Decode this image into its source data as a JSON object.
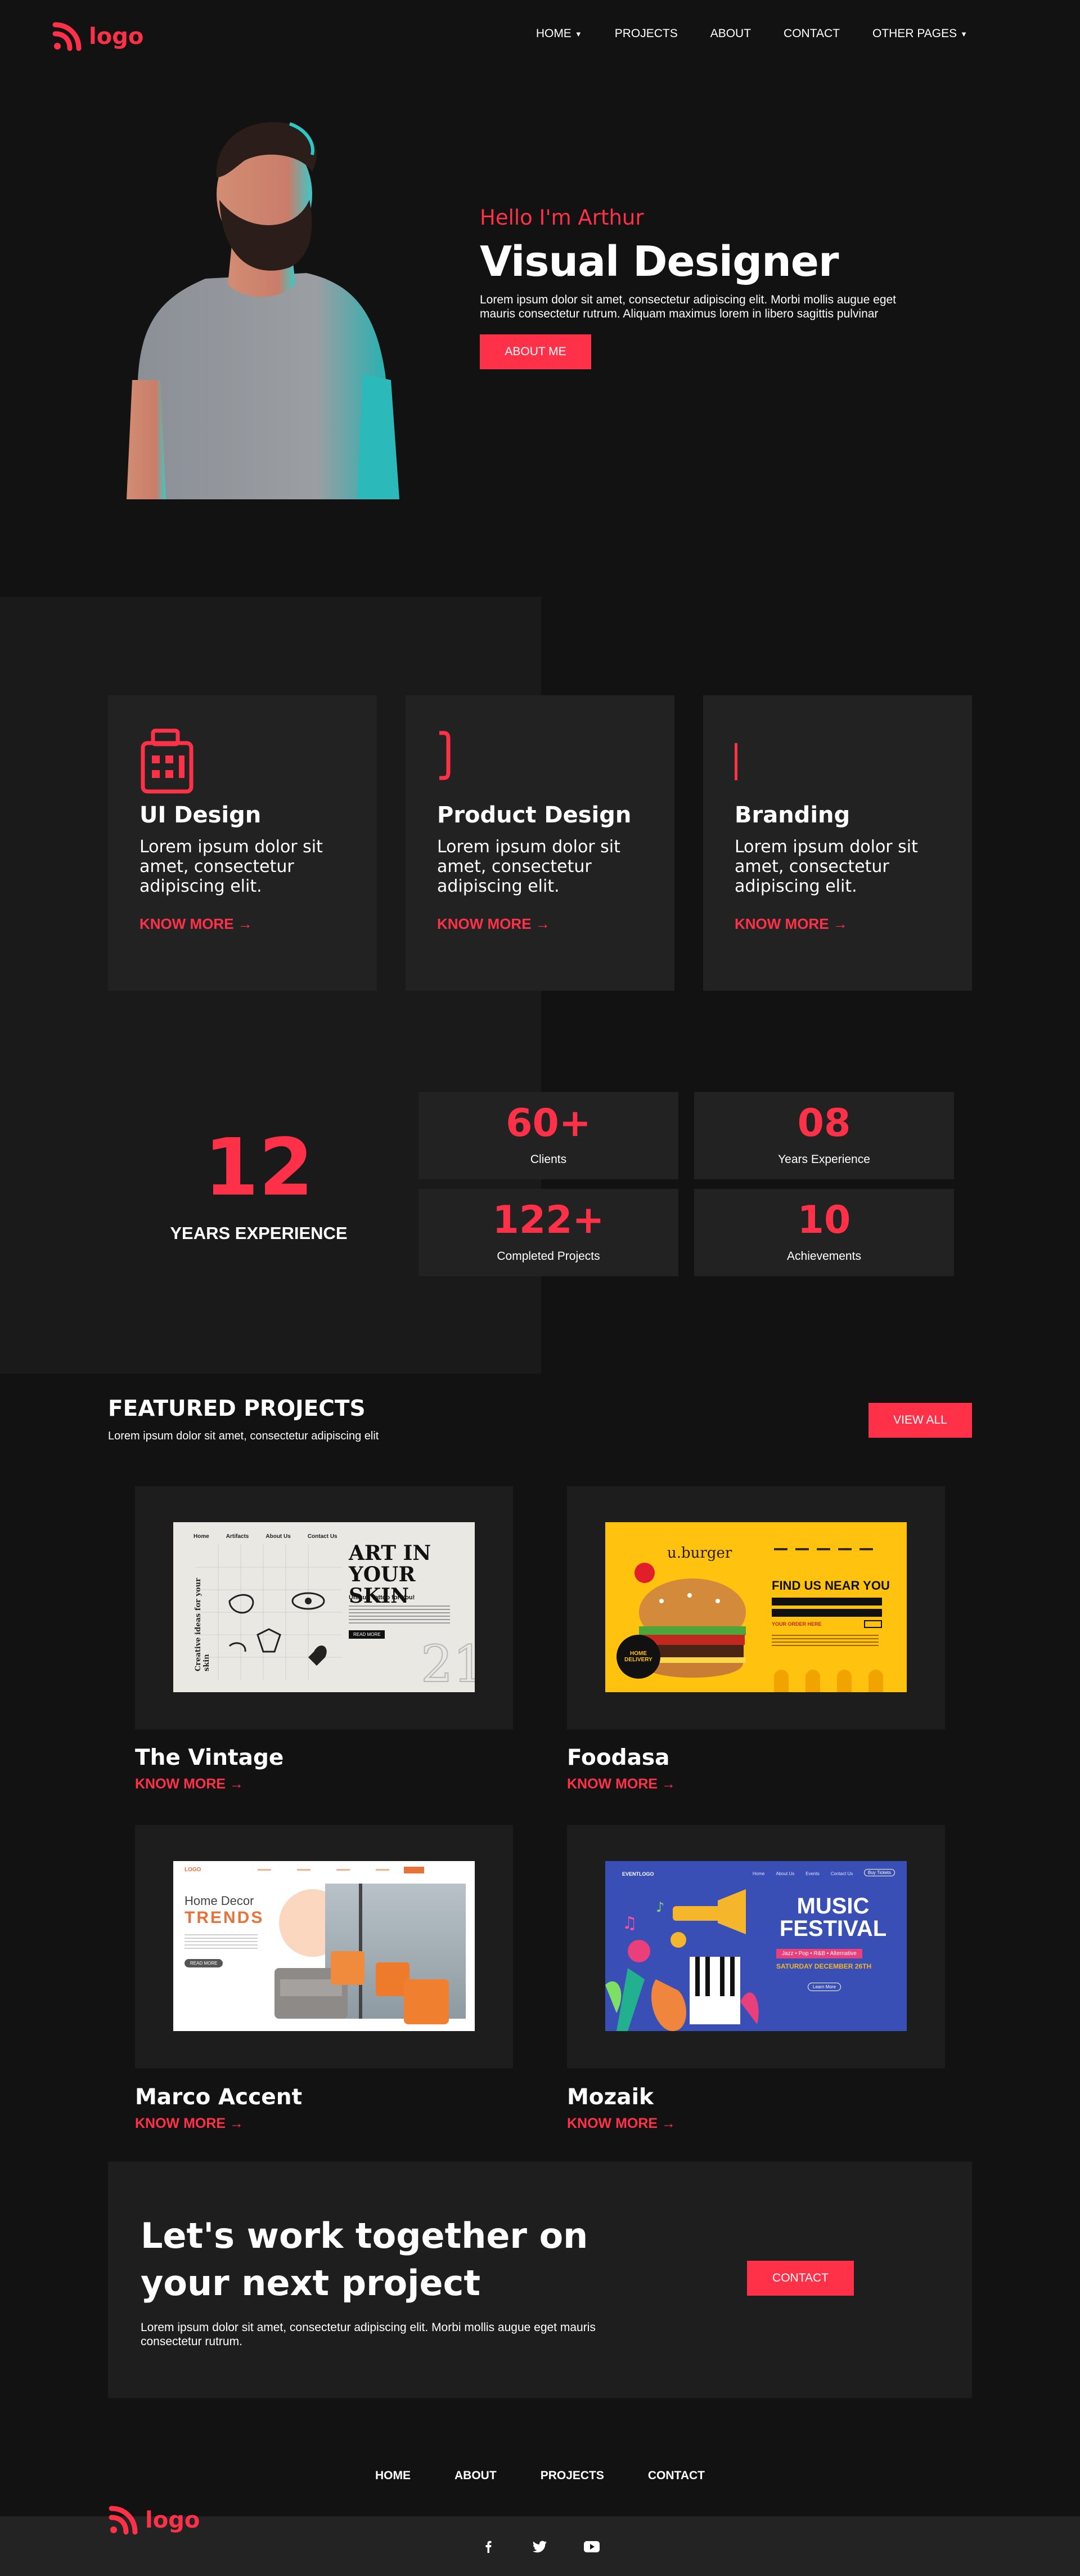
{
  "header": {
    "logo_text": "logo",
    "nav": [
      {
        "label": "HOME",
        "dropdown": true
      },
      {
        "label": "PROJECTS",
        "dropdown": false
      },
      {
        "label": "ABOUT",
        "dropdown": false
      },
      {
        "label": "CONTACT",
        "dropdown": false
      },
      {
        "label": "OTHER PAGES",
        "dropdown": true
      }
    ]
  },
  "hero": {
    "greeting": "Hello I'm Arthur",
    "title": "Visual Designer",
    "description": "Lorem ipsum dolor sit amet, consectetur adipiscing elit. Morbi mollis augue eget mauris consectetur rutrum. Aliquam maximus lorem in libero sagittis pulvinar",
    "button": "ABOUT ME"
  },
  "services": [
    {
      "title": "UI Design",
      "description": "Lorem ipsum dolor sit amet, consectetur adipiscing elit.",
      "link": "KNOW MORE →",
      "icon": "calculator-icon"
    },
    {
      "title": "Product Design",
      "description": "Lorem ipsum dolor sit amet, consectetur adipiscing elit.",
      "link": "KNOW MORE →",
      "icon": "bracket-icon"
    },
    {
      "title": "Branding",
      "description": "Lorem ipsum dolor sit amet, consectetur adipiscing elit.",
      "link": "KNOW MORE →",
      "icon": "line-icon"
    }
  ],
  "experience": {
    "big_number": "12",
    "big_label": "YEARS EXPERIENCE",
    "stats": [
      {
        "value": "60+",
        "label": "Clients"
      },
      {
        "value": "08",
        "label": "Years Experience"
      },
      {
        "value": "122+",
        "label": "Completed Projects"
      },
      {
        "value": "10",
        "label": "Achievements"
      }
    ]
  },
  "featured": {
    "title": "FEATURED PROJECTS",
    "subtitle": "Lorem ipsum dolor sit amet, consectetur adipiscing elit",
    "view_all": "VIEW ALL",
    "projects": [
      {
        "title": "The Vintage",
        "link": "KNOW MORE →",
        "thumb": {
          "nav": [
            "Home",
            "Artifacts",
            "About Us",
            "Contact Us"
          ],
          "side": "Creative ideas for your skin",
          "headline1": "ART IN",
          "headline2": "YOUR SKIN",
          "tagline": "Unique Tattoo for You!",
          "button": "READ MORE"
        }
      },
      {
        "title": "Foodasa",
        "link": "KNOW MORE →",
        "thumb": {
          "brand": "u.burger",
          "heading": "FIND US NEAR YOU",
          "badge": "HOME DELIVERY",
          "cta": "YOUR ORDER HERE"
        }
      },
      {
        "title": "Marco Accent",
        "link": "KNOW MORE →",
        "thumb": {
          "brand": "LOGO",
          "line1": "Home Decor",
          "line2": "TRENDS",
          "button": "READ MORE"
        }
      },
      {
        "title": "Mozaik",
        "link": "KNOW MORE →",
        "thumb": {
          "brand": "EVENTLOGO",
          "nav": [
            "Home",
            "About Us",
            "Events",
            "Contact Us"
          ],
          "button": "Buy Tickets",
          "title1": "MUSIC",
          "title2": "FESTIVAL",
          "genres": "Jazz • Pop • R&B • Alternative",
          "date": "SATURDAY DECEMBER 26TH",
          "learn": "Learn More"
        }
      }
    ]
  },
  "cta": {
    "title": "Let's work together on your next project",
    "description": "Lorem ipsum dolor sit amet, consectetur adipiscing elit. Morbi mollis augue eget mauris consectetur rutrum.",
    "button": "CONTACT"
  },
  "footer": {
    "nav": [
      "HOME",
      "ABOUT",
      "PROJECTS",
      "CONTACT"
    ],
    "logo_text": "logo",
    "social": [
      "facebook-icon",
      "twitter-icon",
      "youtube-icon"
    ]
  },
  "colors": {
    "accent": "#ff3148",
    "background": "#121212",
    "panel": "#1a1a1a",
    "card": "#222222"
  }
}
